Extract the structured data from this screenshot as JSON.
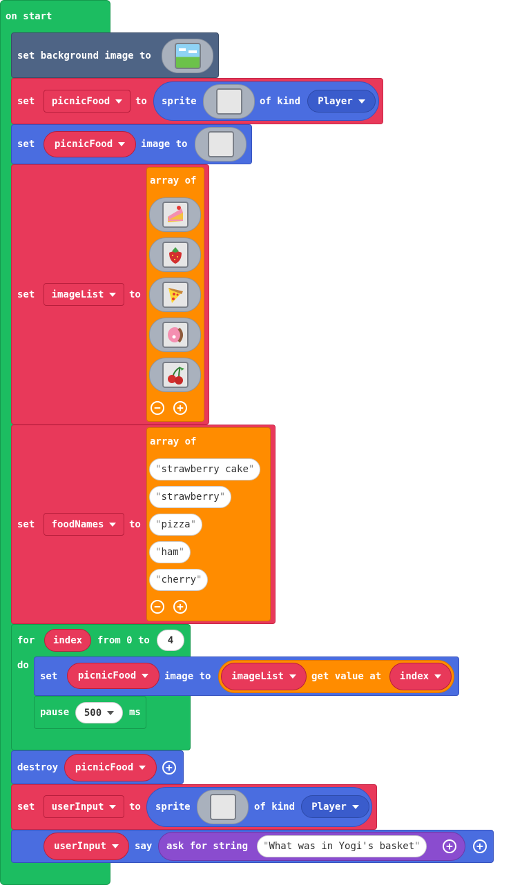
{
  "on_start": {
    "label": "on start"
  },
  "set_bg": {
    "label": "set background image to",
    "image_icon": "landscape-image-icon"
  },
  "set_sprite": {
    "set": "set",
    "var": "picnicFood",
    "to": "to",
    "sprite": "sprite",
    "of_kind": "of kind",
    "kind": "Player"
  },
  "set_image": {
    "set": "set",
    "var": "picnicFood",
    "image_to": "image to"
  },
  "image_list": {
    "set": "set",
    "var": "imageList",
    "to": "to",
    "array_of": "array of",
    "items": [
      {
        "icon": "strawberry-cake-icon"
      },
      {
        "icon": "strawberry-icon"
      },
      {
        "icon": "pizza-icon"
      },
      {
        "icon": "ham-icon"
      },
      {
        "icon": "cherry-icon"
      }
    ]
  },
  "food_names": {
    "set": "set",
    "var": "foodNames",
    "to": "to",
    "array_of": "array of",
    "items": [
      "strawberry cake",
      "strawberry",
      "pizza",
      "ham",
      "cherry"
    ]
  },
  "loop": {
    "for": "for",
    "var": "index",
    "from": "from 0 to",
    "end": "4",
    "do": "do",
    "set": "set",
    "target": "picnicFood",
    "image_to": "image to",
    "list": "imageList",
    "get_value_at": "get value at",
    "index_var": "index",
    "pause": "pause",
    "ms_value": "500",
    "ms": "ms"
  },
  "destroy": {
    "label": "destroy",
    "var": "picnicFood"
  },
  "set_user": {
    "set": "set",
    "var": "userInput",
    "to": "to",
    "sprite": "sprite",
    "of_kind": "of kind",
    "kind": "Player"
  },
  "say": {
    "var": "userInput",
    "say": "say",
    "ask": "ask for string",
    "prompt": "What was in Yogi's basket"
  },
  "colors": {
    "loops": "#1cbd61",
    "variables": "#e8395a",
    "sprites": "#4a6de0",
    "scene": "#4e6485",
    "arrays": "#ff8c00",
    "game": "#8a4ccf"
  }
}
